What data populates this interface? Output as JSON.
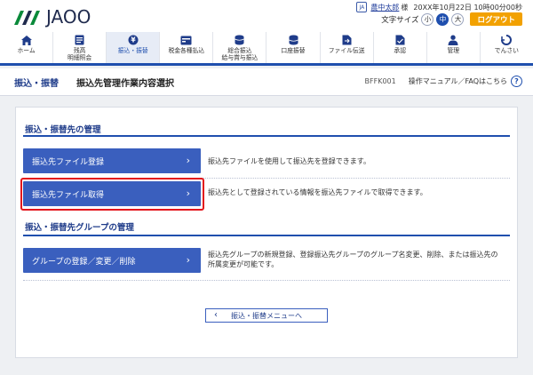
{
  "brand": {
    "logo_text": "JAOO"
  },
  "user": {
    "icon_label": "JA",
    "name": "農中太郎",
    "honorific": "様",
    "last_login": "20XX年10月22日 10時00分00秒"
  },
  "font_size": {
    "label": "文字サイズ",
    "options": [
      "小",
      "中",
      "大"
    ],
    "selected": "中"
  },
  "logout_label": "ログアウト",
  "nav": {
    "items": [
      {
        "label": "ホーム",
        "icon": "home-icon"
      },
      {
        "label": "残高\n明細照会",
        "icon": "passbook-icon"
      },
      {
        "label": "振込・振替",
        "icon": "transfer-icon",
        "active": true
      },
      {
        "label": "税金各種払込",
        "icon": "tax-payment-icon"
      },
      {
        "label": "総合振込\n給与賞与振込",
        "icon": "bulk-transfer-icon"
      },
      {
        "label": "口座振替",
        "icon": "account-debit-icon"
      },
      {
        "label": "ファイル伝送",
        "icon": "file-transfer-icon"
      },
      {
        "label": "承認",
        "icon": "approval-icon"
      },
      {
        "label": "管理",
        "icon": "admin-icon"
      },
      {
        "label": "でんさい",
        "icon": "densai-icon"
      }
    ]
  },
  "page": {
    "section": "振込・振替",
    "title": "振込先管理作業内容選択",
    "screen_code": "BFFK001",
    "help_link": "操作マニュアル／FAQはこちら",
    "help_icon": "?"
  },
  "sections": [
    {
      "title": "振込・振替先の管理",
      "rows": [
        {
          "button": "振込先ファイル登録",
          "desc": "振込先ファイルを使用して振込先を登録できます。"
        },
        {
          "button": "振込先ファイル取得",
          "desc": "振込先として登録されている情報を振込先ファイルで取得できます。",
          "highlighted": true
        }
      ]
    },
    {
      "title": "振込・振替先グループの管理",
      "rows": [
        {
          "button": "グループの登録／変更／削除",
          "desc": "振込先グループの新規登録、登録振込先グループのグループ名変更、削除、または振込先の所属変更が可能です。"
        }
      ]
    }
  ],
  "back_button": "振込・振替メニューへ",
  "colors": {
    "primary": "#1f4fae",
    "button": "#3a5fbe",
    "logout": "#f2a100",
    "highlight": "#e3161c",
    "brand_green": "#0a8a3a"
  }
}
